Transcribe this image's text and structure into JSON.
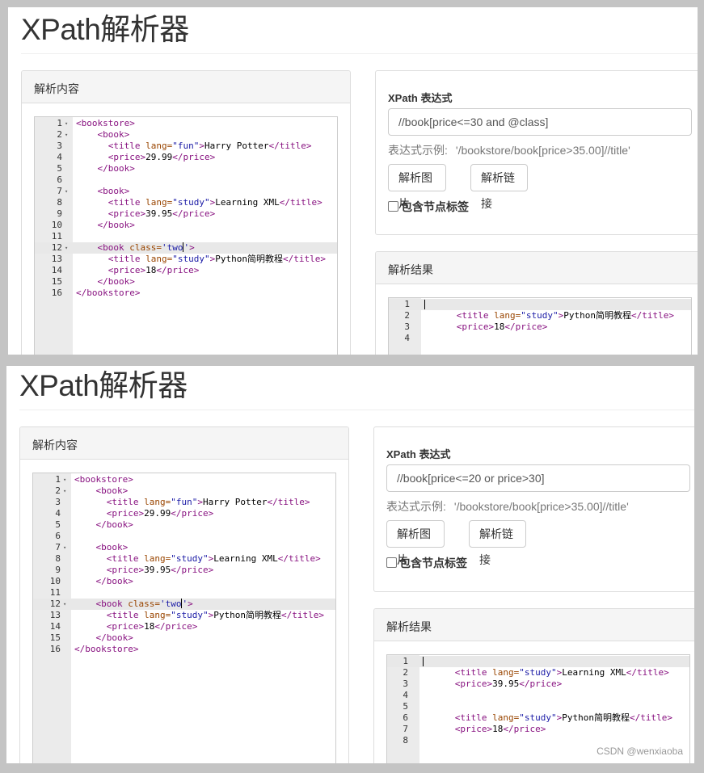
{
  "screenshots": [
    {
      "page_title": "XPath解析器",
      "content_panel_title": "解析内容",
      "xpath_label": "XPath 表达式",
      "xpath_value": "//book[price<=30 and @class]",
      "hint_label": "表达式示例:",
      "hint_value": "'/bookstore/book[price>35.00]//title'",
      "btn_image": "解析图片",
      "btn_link": "解析链接",
      "checkbox_label": "包含节点标签",
      "result_panel_title": "解析结果",
      "result_lines": [
        {
          "n": "1",
          "text": ""
        },
        {
          "n": "2",
          "text": "<title lang=\"study\">Python简明教程</title>"
        },
        {
          "n": "3",
          "text": "<price>18</price>"
        },
        {
          "n": "4",
          "text": ""
        }
      ]
    },
    {
      "page_title": "XPath解析器",
      "content_panel_title": "解析内容",
      "xpath_label": "XPath 表达式",
      "xpath_value": "//book[price<=20 or price>30]",
      "hint_label": "表达式示例:",
      "hint_value": "'/bookstore/book[price>35.00]//title'",
      "btn_image": "解析图片",
      "btn_link": "解析链接",
      "checkbox_label": "包含节点标签",
      "result_panel_title": "解析结果",
      "result_lines": [
        {
          "n": "1",
          "text": ""
        },
        {
          "n": "2",
          "text": "<title lang=\"study\">Learning XML</title>"
        },
        {
          "n": "3",
          "text": "<price>39.95</price>"
        },
        {
          "n": "4",
          "text": ""
        },
        {
          "n": "5",
          "text": ""
        },
        {
          "n": "6",
          "text": "<title lang=\"study\">Python简明教程</title>"
        },
        {
          "n": "7",
          "text": "<price>18</price>"
        },
        {
          "n": "8",
          "text": ""
        }
      ]
    }
  ],
  "source_lines": [
    {
      "n": "1",
      "fold": true,
      "text": "<bookstore>"
    },
    {
      "n": "2",
      "fold": true,
      "text": "    <book>"
    },
    {
      "n": "3",
      "fold": false,
      "text": "      <title lang=\"fun\">Harry Potter</title>"
    },
    {
      "n": "4",
      "fold": false,
      "text": "      <price>29.99</price>"
    },
    {
      "n": "5",
      "fold": false,
      "text": "    </book>"
    },
    {
      "n": "6",
      "fold": false,
      "text": ""
    },
    {
      "n": "7",
      "fold": true,
      "text": "    <book>"
    },
    {
      "n": "8",
      "fold": false,
      "text": "      <title lang=\"study\">Learning XML</title>"
    },
    {
      "n": "9",
      "fold": false,
      "text": "      <price>39.95</price>"
    },
    {
      "n": "10",
      "fold": false,
      "text": "    </book>"
    },
    {
      "n": "11",
      "fold": false,
      "text": ""
    },
    {
      "n": "12",
      "fold": true,
      "text": "    <book class='two'>"
    },
    {
      "n": "13",
      "fold": false,
      "text": "      <title lang=\"study\">Python简明教程</title>"
    },
    {
      "n": "14",
      "fold": false,
      "text": "      <price>18</price>"
    },
    {
      "n": "15",
      "fold": false,
      "text": "    </book>"
    },
    {
      "n": "16",
      "fold": false,
      "text": "</bookstore>"
    }
  ],
  "active_line": "12",
  "fold_glyph": "▾",
  "watermark": "CSDN @wenxiaoba",
  "colors": {
    "tag": "#881280",
    "attr": "#994500",
    "value": "#1a1aa6",
    "gutter_bg": "#ebebeb",
    "heading_bg": "#f5f5f5"
  }
}
